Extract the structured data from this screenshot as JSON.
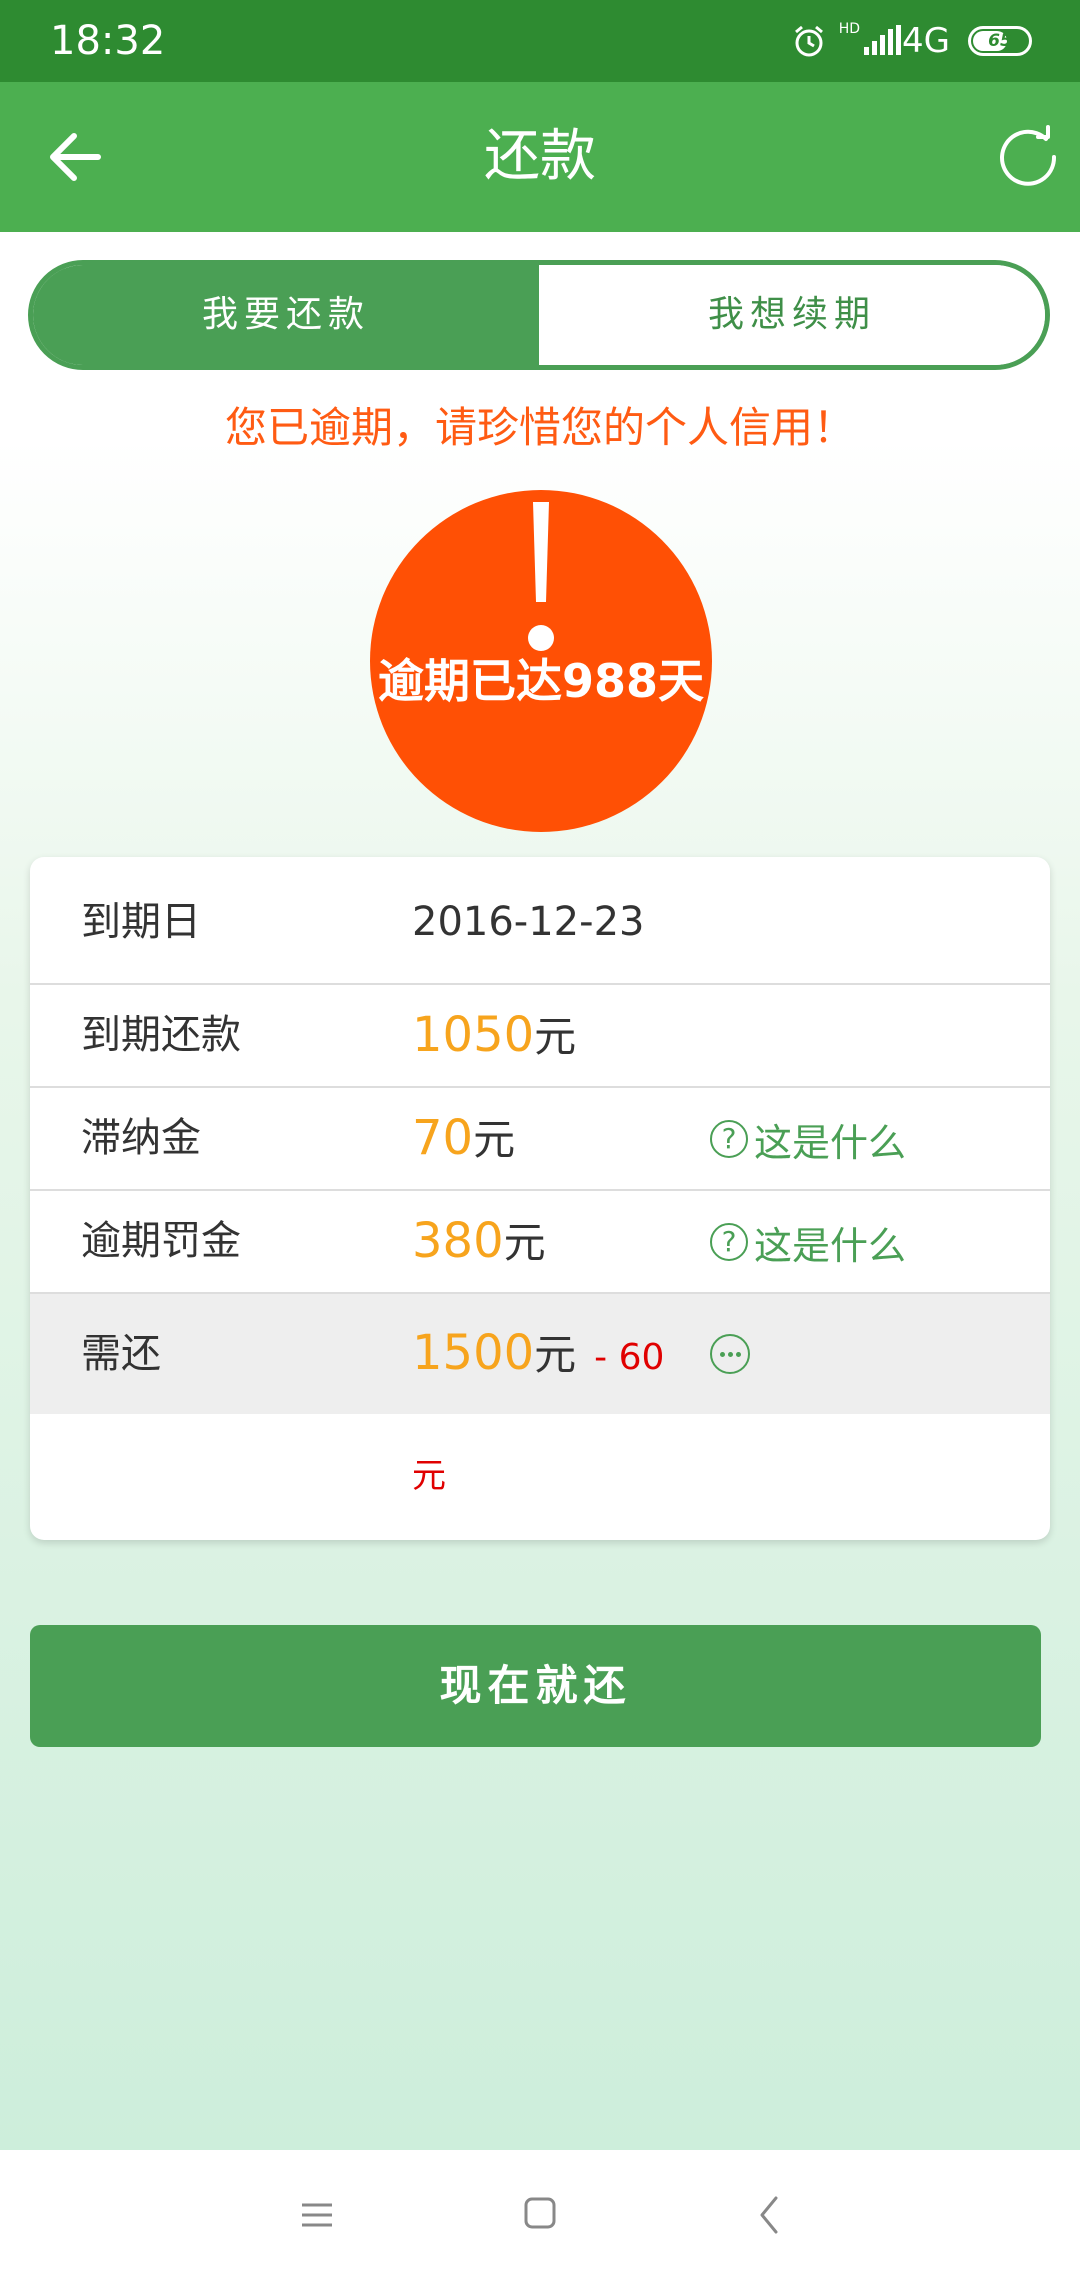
{
  "status_bar": {
    "time": "18:32",
    "hd": "HD",
    "network": "4G",
    "battery": "65",
    "battery_level_percent": 65,
    "icons": [
      "alarm-icon",
      "signal-icon",
      "battery-icon"
    ]
  },
  "app_bar": {
    "title": "还款",
    "icons": [
      "arrow-left-icon",
      "refresh-icon"
    ]
  },
  "tabs": [
    {
      "label": "我要还款",
      "active": true
    },
    {
      "label": "我想续期",
      "active": false
    }
  ],
  "warning": "您已逾期，请珍惜您的个人信用！",
  "overdue": {
    "text": "逾期已达988天",
    "icon": "exclamation-icon"
  },
  "details": {
    "due_date": {
      "label": "到期日",
      "value": "2016-12-23"
    },
    "due_repayment": {
      "label": "到期还款",
      "amount": "1050",
      "unit": "元"
    },
    "late_fee": {
      "label": "滞纳金",
      "amount": "70",
      "unit": "元",
      "help": "这是什么"
    },
    "overdue_penalty": {
      "label": "逾期罚金",
      "amount": "380",
      "unit": "元",
      "help": "这是什么"
    },
    "total_due": {
      "label": "需还",
      "amount": "1500",
      "unit": "元",
      "discount": "- 60",
      "discount_unit": "元"
    }
  },
  "pay_button": "现在就还",
  "nav_bar": {
    "icons": [
      "menu-icon",
      "home-icon",
      "back-icon"
    ]
  },
  "colors": {
    "status_bar": "#2e8b31",
    "app_bar": "#4caf50",
    "accent_green": "#4a9f55",
    "warning_orange": "#ff5b13",
    "overdue_circle": "#ff5005",
    "amount_orange": "#f7a41d",
    "discount_red": "#e00000"
  }
}
